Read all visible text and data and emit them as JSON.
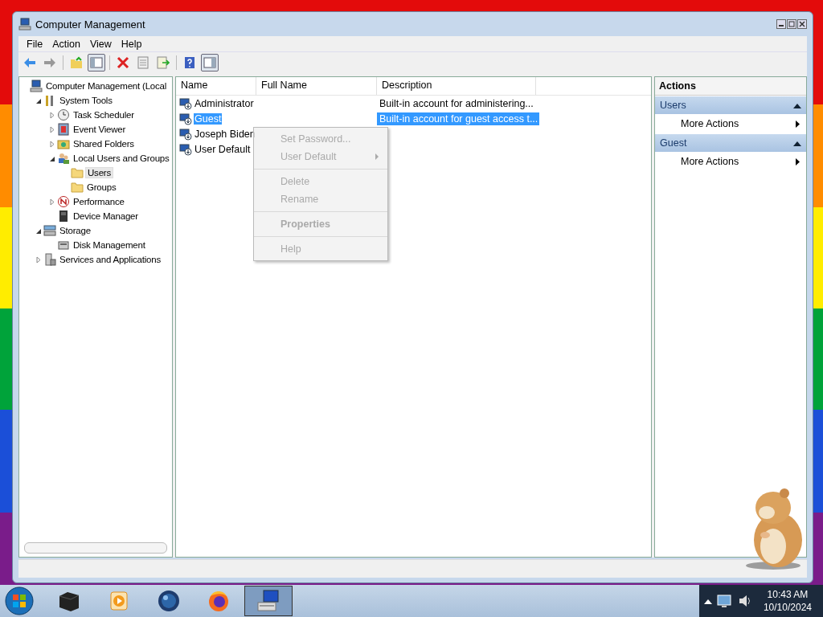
{
  "window": {
    "title": "Computer Management"
  },
  "menu_bar": [
    "File",
    "Action",
    "View",
    "Help"
  ],
  "toolbar": [
    {
      "kind": "back",
      "selected": false
    },
    {
      "kind": "forward",
      "selected": false
    },
    {
      "kind": "up",
      "selected": false
    },
    {
      "kind": "tree",
      "selected": true
    },
    {
      "kind": "delete",
      "selected": false
    },
    {
      "kind": "properties",
      "selected": false
    },
    {
      "kind": "export",
      "selected": false
    },
    {
      "kind": "help",
      "selected": false
    },
    {
      "kind": "actionpane",
      "selected": true
    }
  ],
  "tree": [
    {
      "label": "Computer Management (Local",
      "kind": "computer",
      "selected": false,
      "children": [
        {
          "label": "System Tools",
          "kind": "tools",
          "expanded": true,
          "selected": false,
          "children": [
            {
              "label": "Task Scheduler",
              "kind": "clock",
              "expanded": false,
              "selected": false
            },
            {
              "label": "Event Viewer",
              "kind": "viewer",
              "expanded": false,
              "selected": false
            },
            {
              "label": "Shared Folders",
              "kind": "shared",
              "expanded": false,
              "selected": false
            },
            {
              "label": "Local Users and Groups",
              "kind": "users",
              "expanded": true,
              "selected": false,
              "children": [
                {
                  "label": "Users",
                  "kind": "folder",
                  "selected": true
                },
                {
                  "label": "Groups",
                  "kind": "folder",
                  "selected": false
                }
              ]
            },
            {
              "label": "Performance",
              "kind": "perf",
              "expanded": false,
              "selected": false
            },
            {
              "label": "Device Manager",
              "kind": "device",
              "selected": false
            }
          ]
        },
        {
          "label": "Storage",
          "kind": "storage",
          "expanded": true,
          "selected": false,
          "children": [
            {
              "label": "Disk Management",
              "kind": "disk",
              "selected": false
            }
          ]
        },
        {
          "label": "Services and Applications",
          "kind": "services",
          "expanded": false,
          "selected": false
        }
      ]
    }
  ],
  "list": {
    "columns": [
      "Name",
      "Full Name",
      "Description"
    ],
    "rows": [
      {
        "name": "Administrator",
        "description": "Built-in account for administering...",
        "selected": false
      },
      {
        "name": "Guest",
        "description": "Built-in account for guest access t...",
        "selected": true
      },
      {
        "name": "Joseph Biden",
        "selected": false
      },
      {
        "name": "User Default",
        "selected": false
      }
    ]
  },
  "context_menu": [
    {
      "label": "Set Password...",
      "kind": "item",
      "disabled": true,
      "separator_before": false
    },
    {
      "label": "User Default",
      "kind": "submenu",
      "disabled": true,
      "separator_before": false
    },
    {
      "label": "Delete",
      "kind": "item",
      "disabled": true,
      "separator_before": true
    },
    {
      "label": "Rename",
      "kind": "item",
      "disabled": true,
      "separator_before": false
    },
    {
      "label": "Properties",
      "kind": "default",
      "disabled": true,
      "separator_before": true
    },
    {
      "label": "Help",
      "kind": "item",
      "disabled": true,
      "separator_before": true
    }
  ],
  "actions": {
    "title": "Actions",
    "sections": [
      {
        "title": "Users",
        "expanded": true,
        "items": [
          "More Actions"
        ]
      },
      {
        "title": "Guest",
        "expanded": true,
        "items": [
          "More Actions"
        ]
      }
    ]
  },
  "taskbar": {
    "apps": [
      {
        "kind": "box",
        "selected": false
      },
      {
        "kind": "media",
        "selected": false
      },
      {
        "kind": "globe",
        "selected": false
      },
      {
        "kind": "firefox",
        "selected": false
      },
      {
        "kind": "computer",
        "selected": true
      }
    ],
    "time": "10:43 AM",
    "date": "10/10/2024"
  }
}
